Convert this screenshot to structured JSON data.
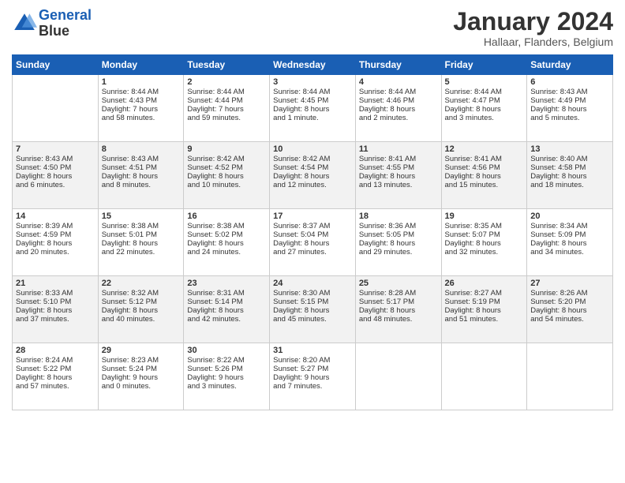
{
  "header": {
    "logo_line1": "General",
    "logo_line2": "Blue",
    "month": "January 2024",
    "location": "Hallaar, Flanders, Belgium"
  },
  "days_of_week": [
    "Sunday",
    "Monday",
    "Tuesday",
    "Wednesday",
    "Thursday",
    "Friday",
    "Saturday"
  ],
  "weeks": [
    [
      {
        "day": "",
        "info": ""
      },
      {
        "day": "1",
        "info": "Sunrise: 8:44 AM\nSunset: 4:43 PM\nDaylight: 7 hours\nand 58 minutes."
      },
      {
        "day": "2",
        "info": "Sunrise: 8:44 AM\nSunset: 4:44 PM\nDaylight: 7 hours\nand 59 minutes."
      },
      {
        "day": "3",
        "info": "Sunrise: 8:44 AM\nSunset: 4:45 PM\nDaylight: 8 hours\nand 1 minute."
      },
      {
        "day": "4",
        "info": "Sunrise: 8:44 AM\nSunset: 4:46 PM\nDaylight: 8 hours\nand 2 minutes."
      },
      {
        "day": "5",
        "info": "Sunrise: 8:44 AM\nSunset: 4:47 PM\nDaylight: 8 hours\nand 3 minutes."
      },
      {
        "day": "6",
        "info": "Sunrise: 8:43 AM\nSunset: 4:49 PM\nDaylight: 8 hours\nand 5 minutes."
      }
    ],
    [
      {
        "day": "7",
        "info": "Sunrise: 8:43 AM\nSunset: 4:50 PM\nDaylight: 8 hours\nand 6 minutes."
      },
      {
        "day": "8",
        "info": "Sunrise: 8:43 AM\nSunset: 4:51 PM\nDaylight: 8 hours\nand 8 minutes."
      },
      {
        "day": "9",
        "info": "Sunrise: 8:42 AM\nSunset: 4:52 PM\nDaylight: 8 hours\nand 10 minutes."
      },
      {
        "day": "10",
        "info": "Sunrise: 8:42 AM\nSunset: 4:54 PM\nDaylight: 8 hours\nand 12 minutes."
      },
      {
        "day": "11",
        "info": "Sunrise: 8:41 AM\nSunset: 4:55 PM\nDaylight: 8 hours\nand 13 minutes."
      },
      {
        "day": "12",
        "info": "Sunrise: 8:41 AM\nSunset: 4:56 PM\nDaylight: 8 hours\nand 15 minutes."
      },
      {
        "day": "13",
        "info": "Sunrise: 8:40 AM\nSunset: 4:58 PM\nDaylight: 8 hours\nand 18 minutes."
      }
    ],
    [
      {
        "day": "14",
        "info": "Sunrise: 8:39 AM\nSunset: 4:59 PM\nDaylight: 8 hours\nand 20 minutes."
      },
      {
        "day": "15",
        "info": "Sunrise: 8:38 AM\nSunset: 5:01 PM\nDaylight: 8 hours\nand 22 minutes."
      },
      {
        "day": "16",
        "info": "Sunrise: 8:38 AM\nSunset: 5:02 PM\nDaylight: 8 hours\nand 24 minutes."
      },
      {
        "day": "17",
        "info": "Sunrise: 8:37 AM\nSunset: 5:04 PM\nDaylight: 8 hours\nand 27 minutes."
      },
      {
        "day": "18",
        "info": "Sunrise: 8:36 AM\nSunset: 5:05 PM\nDaylight: 8 hours\nand 29 minutes."
      },
      {
        "day": "19",
        "info": "Sunrise: 8:35 AM\nSunset: 5:07 PM\nDaylight: 8 hours\nand 32 minutes."
      },
      {
        "day": "20",
        "info": "Sunrise: 8:34 AM\nSunset: 5:09 PM\nDaylight: 8 hours\nand 34 minutes."
      }
    ],
    [
      {
        "day": "21",
        "info": "Sunrise: 8:33 AM\nSunset: 5:10 PM\nDaylight: 8 hours\nand 37 minutes."
      },
      {
        "day": "22",
        "info": "Sunrise: 8:32 AM\nSunset: 5:12 PM\nDaylight: 8 hours\nand 40 minutes."
      },
      {
        "day": "23",
        "info": "Sunrise: 8:31 AM\nSunset: 5:14 PM\nDaylight: 8 hours\nand 42 minutes."
      },
      {
        "day": "24",
        "info": "Sunrise: 8:30 AM\nSunset: 5:15 PM\nDaylight: 8 hours\nand 45 minutes."
      },
      {
        "day": "25",
        "info": "Sunrise: 8:28 AM\nSunset: 5:17 PM\nDaylight: 8 hours\nand 48 minutes."
      },
      {
        "day": "26",
        "info": "Sunrise: 8:27 AM\nSunset: 5:19 PM\nDaylight: 8 hours\nand 51 minutes."
      },
      {
        "day": "27",
        "info": "Sunrise: 8:26 AM\nSunset: 5:20 PM\nDaylight: 8 hours\nand 54 minutes."
      }
    ],
    [
      {
        "day": "28",
        "info": "Sunrise: 8:24 AM\nSunset: 5:22 PM\nDaylight: 8 hours\nand 57 minutes."
      },
      {
        "day": "29",
        "info": "Sunrise: 8:23 AM\nSunset: 5:24 PM\nDaylight: 9 hours\nand 0 minutes."
      },
      {
        "day": "30",
        "info": "Sunrise: 8:22 AM\nSunset: 5:26 PM\nDaylight: 9 hours\nand 3 minutes."
      },
      {
        "day": "31",
        "info": "Sunrise: 8:20 AM\nSunset: 5:27 PM\nDaylight: 9 hours\nand 7 minutes."
      },
      {
        "day": "",
        "info": ""
      },
      {
        "day": "",
        "info": ""
      },
      {
        "day": "",
        "info": ""
      }
    ]
  ]
}
